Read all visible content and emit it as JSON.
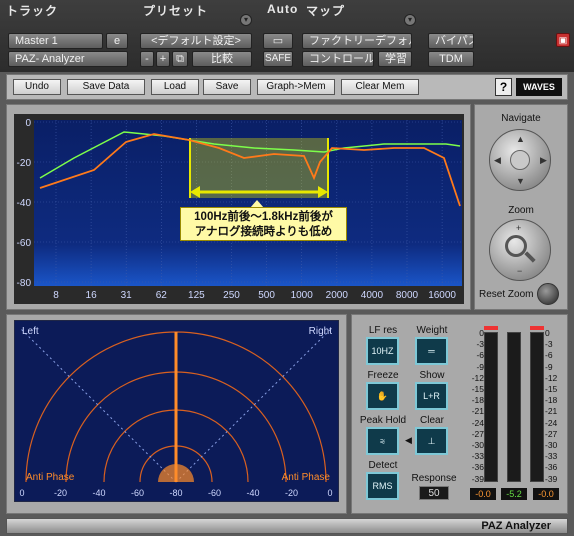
{
  "header": {
    "track_label": "トラック",
    "preset_label": "プリセット",
    "auto_label": "Auto",
    "map_label": "マップ",
    "track_name": "Master 1",
    "track_e": "e",
    "plugin_name": "PAZ- Analyzer",
    "preset_name": "<デフォルト設定>",
    "preset_minus": "-",
    "preset_plus": "+",
    "compare": "比較",
    "safe": "SAFE",
    "factory_default": "ファクトリーデフォルト",
    "control": "コントロール",
    "learn": "学習",
    "bypass": "バイパス",
    "tdm": "TDM"
  },
  "toolbar": {
    "undo": "Undo",
    "save_data": "Save Data",
    "load": "Load",
    "save": "Save",
    "graph_mem": "Graph->Mem",
    "clear_mem": "Clear Mem",
    "help": "?",
    "brand": "WAVES"
  },
  "analyzer": {
    "y_ticks": [
      "0",
      "-20",
      "-40",
      "-60",
      "-80"
    ],
    "x_ticks": [
      "8",
      "16",
      "31",
      "62",
      "125",
      "250",
      "500",
      "1000",
      "2000",
      "4000",
      "8000",
      "16000"
    ],
    "callout_line1": "100Hz前後〜1.8kHz前後が",
    "callout_line2": "アナログ接続時よりも低め"
  },
  "navigate": {
    "navigate_label": "Navigate",
    "zoom_label": "Zoom",
    "reset_zoom_label": "Reset Zoom"
  },
  "phase": {
    "left": "Left",
    "right": "Right",
    "anti_left": "Anti Phase",
    "anti_right": "Anti Phase",
    "x_ticks": [
      "0",
      "-20",
      "-40",
      "-60",
      "-80",
      "-60",
      "-40",
      "-20",
      "0"
    ]
  },
  "controls": {
    "lf_res_label": "LF res",
    "lf_res_value": "10HZ",
    "weight_label": "Weight",
    "freeze_label": "Freeze",
    "show_label": "Show",
    "show_value": "L+R",
    "peak_hold_label": "Peak Hold",
    "clear_label": "Clear",
    "detect_label": "Detect",
    "detect_value": "RMS",
    "response_label": "Response",
    "response_value": "50"
  },
  "meters": {
    "scale": [
      "0",
      "-3",
      "-6",
      "-9",
      "-12",
      "-15",
      "-18",
      "-21",
      "-24",
      "-27",
      "-30",
      "-33",
      "-36",
      "-39"
    ],
    "left_value": "-0.0",
    "mid_value": "-5.2",
    "right_value": "-0.0"
  },
  "footer": {
    "title": "PAZ Analyzer"
  },
  "colors": {
    "orange": "#ff7a1a",
    "green": "#7dff4a",
    "highlight": "#e8e800"
  }
}
